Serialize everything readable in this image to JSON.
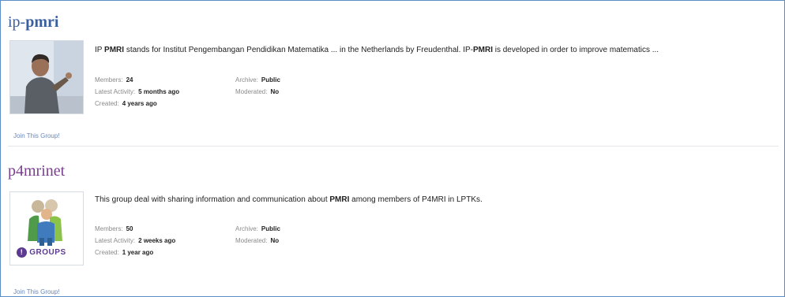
{
  "groups": [
    {
      "title_prefix": "ip-",
      "title_strong": "pmri",
      "join_label": "Join This Group!",
      "description_parts": [
        {
          "text": "IP ",
          "bold": false
        },
        {
          "text": "PMRI",
          "bold": true
        },
        {
          "text": " stands for Institut Pengembangan Pendidikan Matematika ... in the Netherlands by Freudenthal. IP-",
          "bold": false
        },
        {
          "text": "PMRI",
          "bold": true
        },
        {
          "text": " is developed in order to improve matematics ...",
          "bold": false
        }
      ],
      "members_label": "Members:",
      "members": "24",
      "activity_label": "Latest Activity:",
      "activity": "5 months ago",
      "created_label": "Created:",
      "created": "4 years ago",
      "archive_label": "Archive:",
      "archive": "Public",
      "moderated_label": "Moderated:",
      "moderated": "No",
      "image": "person-teaching-photo"
    },
    {
      "title": "p4mrinet",
      "join_label": "Join This Group!",
      "description_parts": [
        {
          "text": "This group deal with sharing information and communication about ",
          "bold": false
        },
        {
          "text": "PMRI",
          "bold": true
        },
        {
          "text": " among members of P4MRI in LPTKs.",
          "bold": false
        }
      ],
      "members_label": "Members:",
      "members": "50",
      "activity_label": "Latest Activity:",
      "activity": "2 weeks ago",
      "created_label": "Created:",
      "created": "1 year ago",
      "archive_label": "Archive:",
      "archive": "Public",
      "moderated_label": "Moderated:",
      "moderated": "No",
      "image": "yahoo-groups-logo",
      "logo_text": "GROUPS"
    }
  ],
  "colors": {
    "border": "#5b8ec6",
    "title1": "#3a5fa0",
    "title2": "#7a3f8e",
    "link": "#6a86b5"
  }
}
